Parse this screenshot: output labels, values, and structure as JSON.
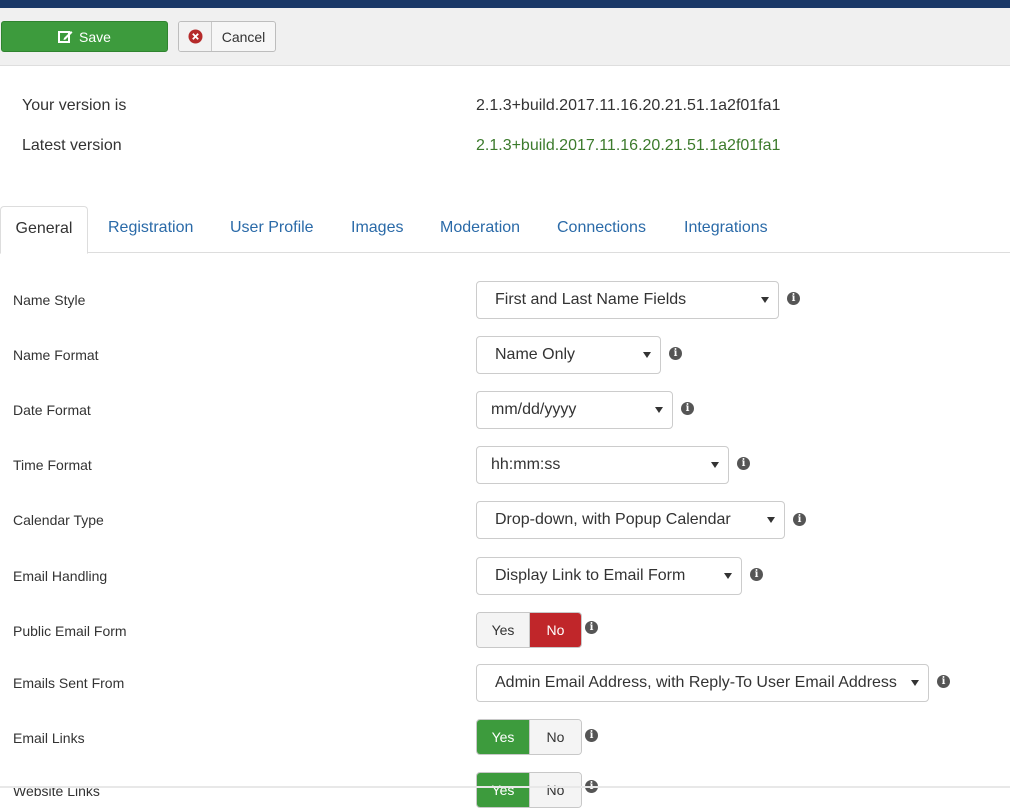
{
  "toolbar": {
    "save_label": "Save",
    "cancel_label": "Cancel"
  },
  "version": {
    "current_label": "Your version is",
    "current_value": "2.1.3+build.2017.11.16.20.21.51.1a2f01fa1",
    "latest_label": "Latest version",
    "latest_value": "2.1.3+build.2017.11.16.20.21.51.1a2f01fa1"
  },
  "tabs": [
    {
      "label": "General",
      "active": true
    },
    {
      "label": "Registration"
    },
    {
      "label": "User Profile"
    },
    {
      "label": "Images"
    },
    {
      "label": "Moderation"
    },
    {
      "label": "Connections"
    },
    {
      "label": "Integrations"
    }
  ],
  "settings": {
    "name_style": {
      "label": "Name Style",
      "value": "First and Last Name Fields"
    },
    "name_format": {
      "label": "Name Format",
      "value": "Name Only"
    },
    "date_format": {
      "label": "Date Format",
      "value": "mm/dd/yyyy"
    },
    "time_format": {
      "label": "Time Format",
      "value": "hh:mm:ss"
    },
    "calendar_type": {
      "label": "Calendar Type",
      "value": "Drop-down, with Popup Calendar"
    },
    "email_handling": {
      "label": "Email Handling",
      "value": "Display Link to Email Form"
    },
    "public_email_form": {
      "label": "Public Email Form",
      "yes": "Yes",
      "no": "No",
      "selected": "No"
    },
    "emails_sent_from": {
      "label": "Emails Sent From",
      "value": "Admin Email Address, with Reply-To User Email Address"
    },
    "email_links": {
      "label": "Email Links",
      "yes": "Yes",
      "no": "No",
      "selected": "Yes"
    },
    "website_links": {
      "label": "Website Links",
      "yes": "Yes",
      "no": "No",
      "selected": "Yes"
    }
  },
  "colors": {
    "save_green": "#3d9b3d",
    "no_red": "#c0262a",
    "link_blue": "#2a6aa8",
    "latest_green": "#3c7a2c",
    "top_bar": "#1a3867"
  }
}
